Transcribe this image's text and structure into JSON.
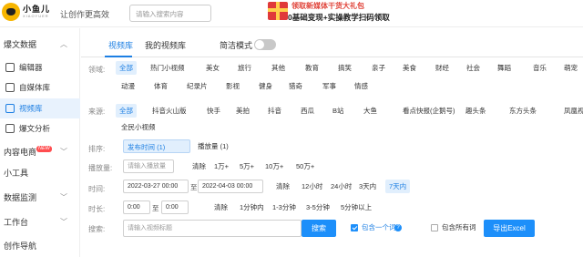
{
  "header": {
    "logo_name": "小鱼儿",
    "logo_sub": "XIAOYUER",
    "slogan": "让创作更高效",
    "search_placeholder": "请输入搜索内容",
    "promo_line1": "领取新媒体干货大礼包",
    "promo_line2": "0基础变现+实操教学扫码领取"
  },
  "sidebar": {
    "groups": [
      {
        "label": "爆文数据"
      },
      {
        "label": "内容电商",
        "badge": "NEW"
      },
      {
        "label": "小工具"
      },
      {
        "label": "数据监测"
      },
      {
        "label": "工作台"
      },
      {
        "label": "创作导航"
      }
    ],
    "items": [
      {
        "label": "编辑器"
      },
      {
        "label": "自媒体库"
      },
      {
        "label": "视频库"
      },
      {
        "label": "爆文分析"
      }
    ]
  },
  "tabs": {
    "video_lib": "视频库",
    "my_video_lib": "我的视频库",
    "simple_mode": "简洁模式"
  },
  "filters": {
    "domain_label": "领域:",
    "domain_row1": [
      "全部",
      "热门小视频",
      "美女",
      "旅行",
      "其他",
      "教育",
      "搞笑",
      "亲子",
      "美食",
      "财经",
      "社会",
      "舞蹈",
      "音乐",
      "萌宠"
    ],
    "domain_row2": [
      "动漫",
      "体育",
      "纪录片",
      "影视",
      "健身",
      "猎奇",
      "军事",
      "情感"
    ],
    "source_label": "来源:",
    "source_row1": [
      "全部",
      "抖音火山版",
      "快手",
      "美拍",
      "抖音",
      "西瓜",
      "B站",
      "大鱼",
      "看点快报(企鹅号)",
      "趣头条",
      "东方头条",
      "凤凰视频"
    ],
    "source_row2": [
      "全民小视频"
    ],
    "sort_label": "排序:",
    "sort_options": [
      "发布时间 (1)",
      "播放量 (1)"
    ],
    "plays_label": "播放量:",
    "plays_placeholder": "请输入播放量",
    "plays_options": [
      "清除",
      "1万+",
      "5万+",
      "10万+",
      "50万+"
    ],
    "time_label": "时间:",
    "time_from": "2022-03-27 00:00",
    "time_to_word": "至",
    "time_to": "2022-04-03 00:00",
    "time_options": [
      "清除",
      "12小时",
      "24小时",
      "3天内",
      "7天内"
    ],
    "duration_label": "时长:",
    "duration_min": "0:00",
    "duration_to_word": "至",
    "duration_max": "0:00",
    "duration_options": [
      "清除",
      "1分钟内",
      "1-3分钟",
      "3-5分钟",
      "5分钟以上"
    ],
    "search_label": "搜索:",
    "search_placeholder": "请输入视频标题",
    "search_button": "搜索",
    "contains_one": "包含一个词",
    "contains_all": "包含所有词",
    "export_button": "导出Excel"
  },
  "colors": {
    "accent": "#1d7fe3",
    "button": "#1d8ffa",
    "selected_bg": "#e1effd",
    "badge": "#ff4d4f"
  }
}
